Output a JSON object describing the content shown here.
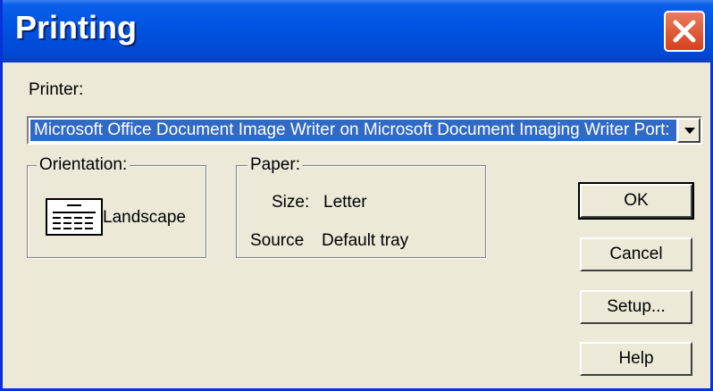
{
  "window": {
    "title": "Printing"
  },
  "printer": {
    "label": "Printer:",
    "selected": "Microsoft Office Document Image Writer on Microsoft Document Imaging Writer Port:"
  },
  "orientation": {
    "title": "Orientation:",
    "value": "Landscape",
    "icon": "landscape-page-icon"
  },
  "paper": {
    "title": "Paper:",
    "size_label": "Size:",
    "size_value": "Letter",
    "source_label": "Source",
    "source_value": "Default tray"
  },
  "buttons": {
    "ok": "OK",
    "cancel": "Cancel",
    "setup": "Setup...",
    "help": "Help"
  },
  "colors": {
    "titlebar": "#0054e3",
    "selection": "#316ac5",
    "close": "#d6401b",
    "dialog_bg": "#ece9d8"
  }
}
